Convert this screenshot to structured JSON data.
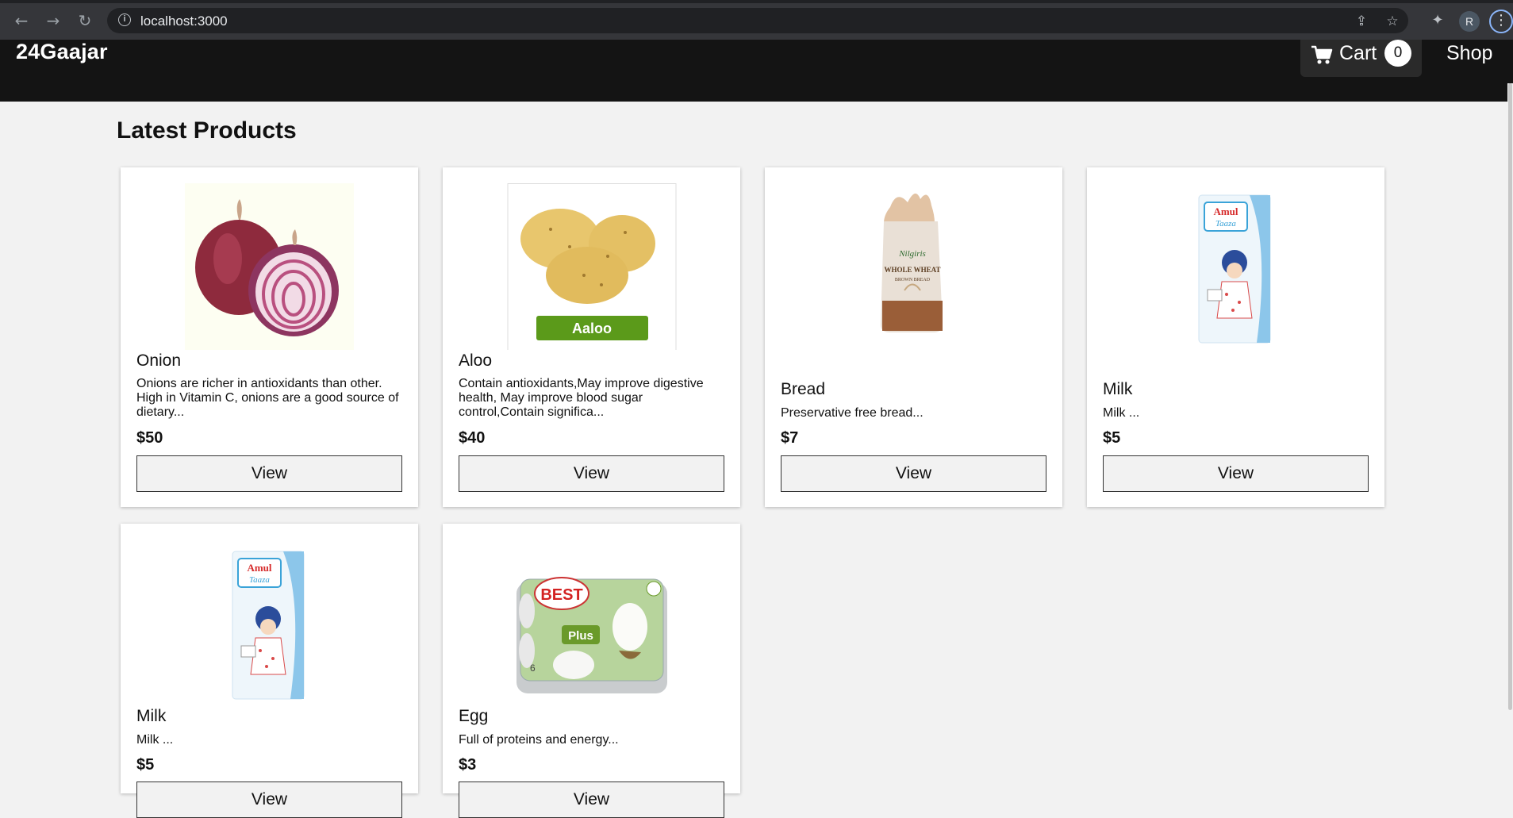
{
  "browser": {
    "url": "localhost:3000",
    "profile_initial": "R"
  },
  "header": {
    "brand": "24Gaajar",
    "cart_label": "Cart",
    "cart_count": "0",
    "shop_label": "Shop"
  },
  "main": {
    "title": "Latest Products",
    "products": [
      {
        "name": "Onion",
        "description": "Onions are richer in antioxidants than other. High in Vitamin C, onions are a good source of dietary...",
        "price": "$50",
        "button": "View"
      },
      {
        "name": "Aloo",
        "description": "Contain antioxidants,May improve digestive health, May improve blood sugar control,Contain significa...",
        "price": "$40",
        "button": "View",
        "image_label": "Aaloo"
      },
      {
        "name": "Bread",
        "description": "Preservative free bread...",
        "price": "$7",
        "button": "View",
        "image_brand": "Nilgiris",
        "image_label": "WHOLE WHEAT",
        "image_sublabel": "BROWN BREAD"
      },
      {
        "name": "Milk",
        "description": "Milk ...",
        "price": "$5",
        "button": "View",
        "image_brand": "Amul",
        "image_label": "Taaza"
      },
      {
        "name": "Milk",
        "description": "Milk ...",
        "price": "$5",
        "button": "View",
        "image_brand": "Amul",
        "image_label": "Taaza"
      },
      {
        "name": "Egg",
        "description": "Full of proteins and energy...",
        "price": "$3",
        "button": "View",
        "image_brand": "BEST",
        "image_label": "Plus",
        "image_count": "6"
      }
    ]
  }
}
